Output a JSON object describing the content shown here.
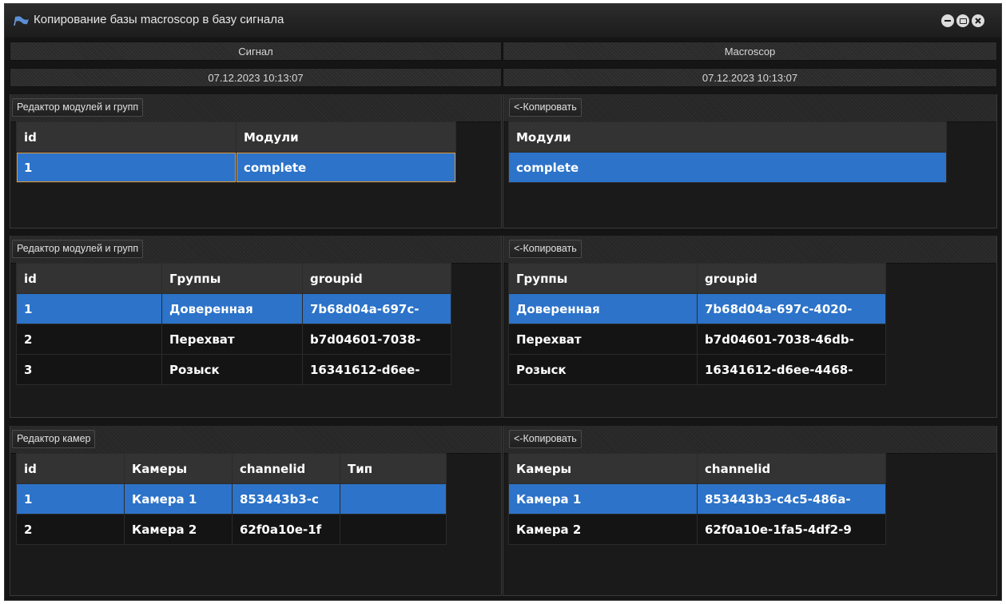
{
  "window": {
    "title": "Копирование базы macroscop в базу сигнала",
    "controls": [
      "minimize-icon",
      "maximize-icon",
      "close-icon"
    ]
  },
  "headers": {
    "left_source": "Сигнал",
    "right_source": "Macroscop",
    "left_timestamp": "07.12.2023 10:13:07",
    "right_timestamp": "07.12.2023 10:13:07"
  },
  "modules": {
    "left_button": "Редактор модулей и групп",
    "right_button": "<-Копировать",
    "left_table": {
      "columns": [
        "id",
        "Модули"
      ],
      "rows": [
        [
          "1",
          "complete"
        ]
      ]
    },
    "right_table": {
      "columns": [
        "Модули"
      ],
      "rows": [
        [
          "complete"
        ]
      ]
    }
  },
  "groups": {
    "left_button": "Редактор модулей и групп",
    "right_button": "<-Копировать",
    "left_table": {
      "columns": [
        "id",
        "Группы",
        "groupid"
      ],
      "rows": [
        [
          "1",
          "Доверенная",
          "7b68d04a-697c-"
        ],
        [
          "2",
          "Перехват",
          "b7d04601-7038-"
        ],
        [
          "3",
          "Розыск",
          "16341612-d6ee-"
        ]
      ]
    },
    "right_table": {
      "columns": [
        "Группы",
        "groupid"
      ],
      "rows": [
        [
          "Доверенная",
          "7b68d04a-697c-4020-"
        ],
        [
          "Перехват",
          "b7d04601-7038-46db-"
        ],
        [
          "Розыск",
          "16341612-d6ee-4468-"
        ]
      ]
    }
  },
  "cameras": {
    "left_button": "Редактор камер",
    "right_button": "<-Копировать",
    "left_table": {
      "columns": [
        "id",
        "Камеры",
        "channelid",
        "Тип"
      ],
      "rows": [
        [
          "1",
          "Камера 1",
          "853443b3-c",
          ""
        ],
        [
          "2",
          "Камера 2",
          "62f0a10e-1f",
          ""
        ]
      ]
    },
    "right_table": {
      "columns": [
        "Камеры",
        "channelid"
      ],
      "rows": [
        [
          "Камера 1",
          "853443b3-c4c5-486a-"
        ],
        [
          "Камера 2",
          "62f0a10e-1fa5-4df2-9"
        ]
      ]
    }
  },
  "colors": {
    "selection": "#2c73c9",
    "background": "#141414",
    "header": "#333333",
    "focus_outline": "#e09a3a"
  }
}
